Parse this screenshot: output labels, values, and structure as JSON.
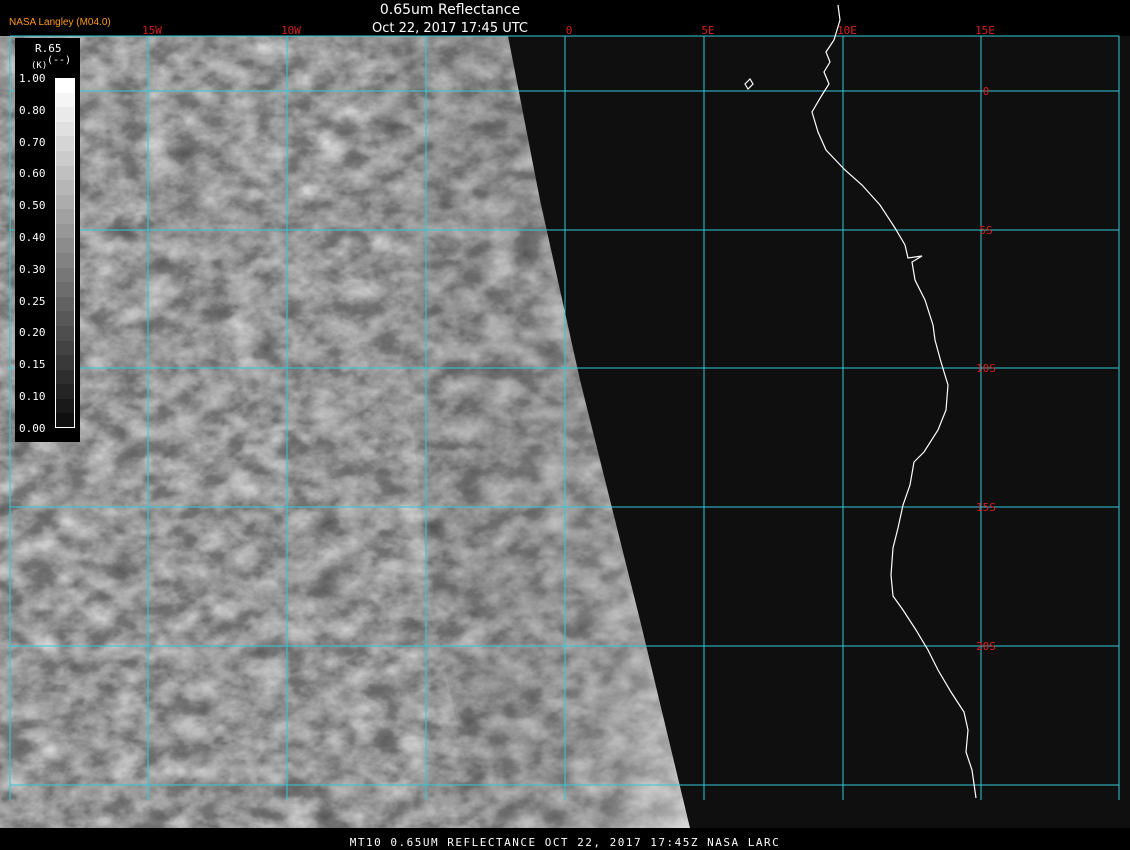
{
  "header": {
    "brand": "NASA Langley (M04.0)",
    "title": "0.65um Reflectance",
    "subtitle": "Oct 22, 2017 17:45 UTC"
  },
  "footer": {
    "caption": "MT10  0.65UM REFLECTANCE  OCT 22, 2017 17:45Z  NASA LARC"
  },
  "legend": {
    "title": "R.65",
    "unit": "(--)",
    "unit_prefix": "(K)",
    "labels": [
      "1.00",
      "0.80",
      "0.70",
      "0.60",
      "0.50",
      "0.40",
      "0.30",
      "0.25",
      "0.20",
      "0.15",
      "0.10",
      "0.00"
    ]
  },
  "grid": {
    "longitude_labels": [
      "15W",
      "10W",
      "0",
      "5E",
      "10E",
      "15E"
    ],
    "latitude_labels": [
      "0",
      "5S",
      "10S",
      "15S",
      "20S"
    ]
  },
  "colors": {
    "grid_line": "#33c8d8",
    "grid_label": "#d42020",
    "brand_text": "#ff9a1a",
    "coastline": "#ffffff",
    "background": "#000000"
  }
}
